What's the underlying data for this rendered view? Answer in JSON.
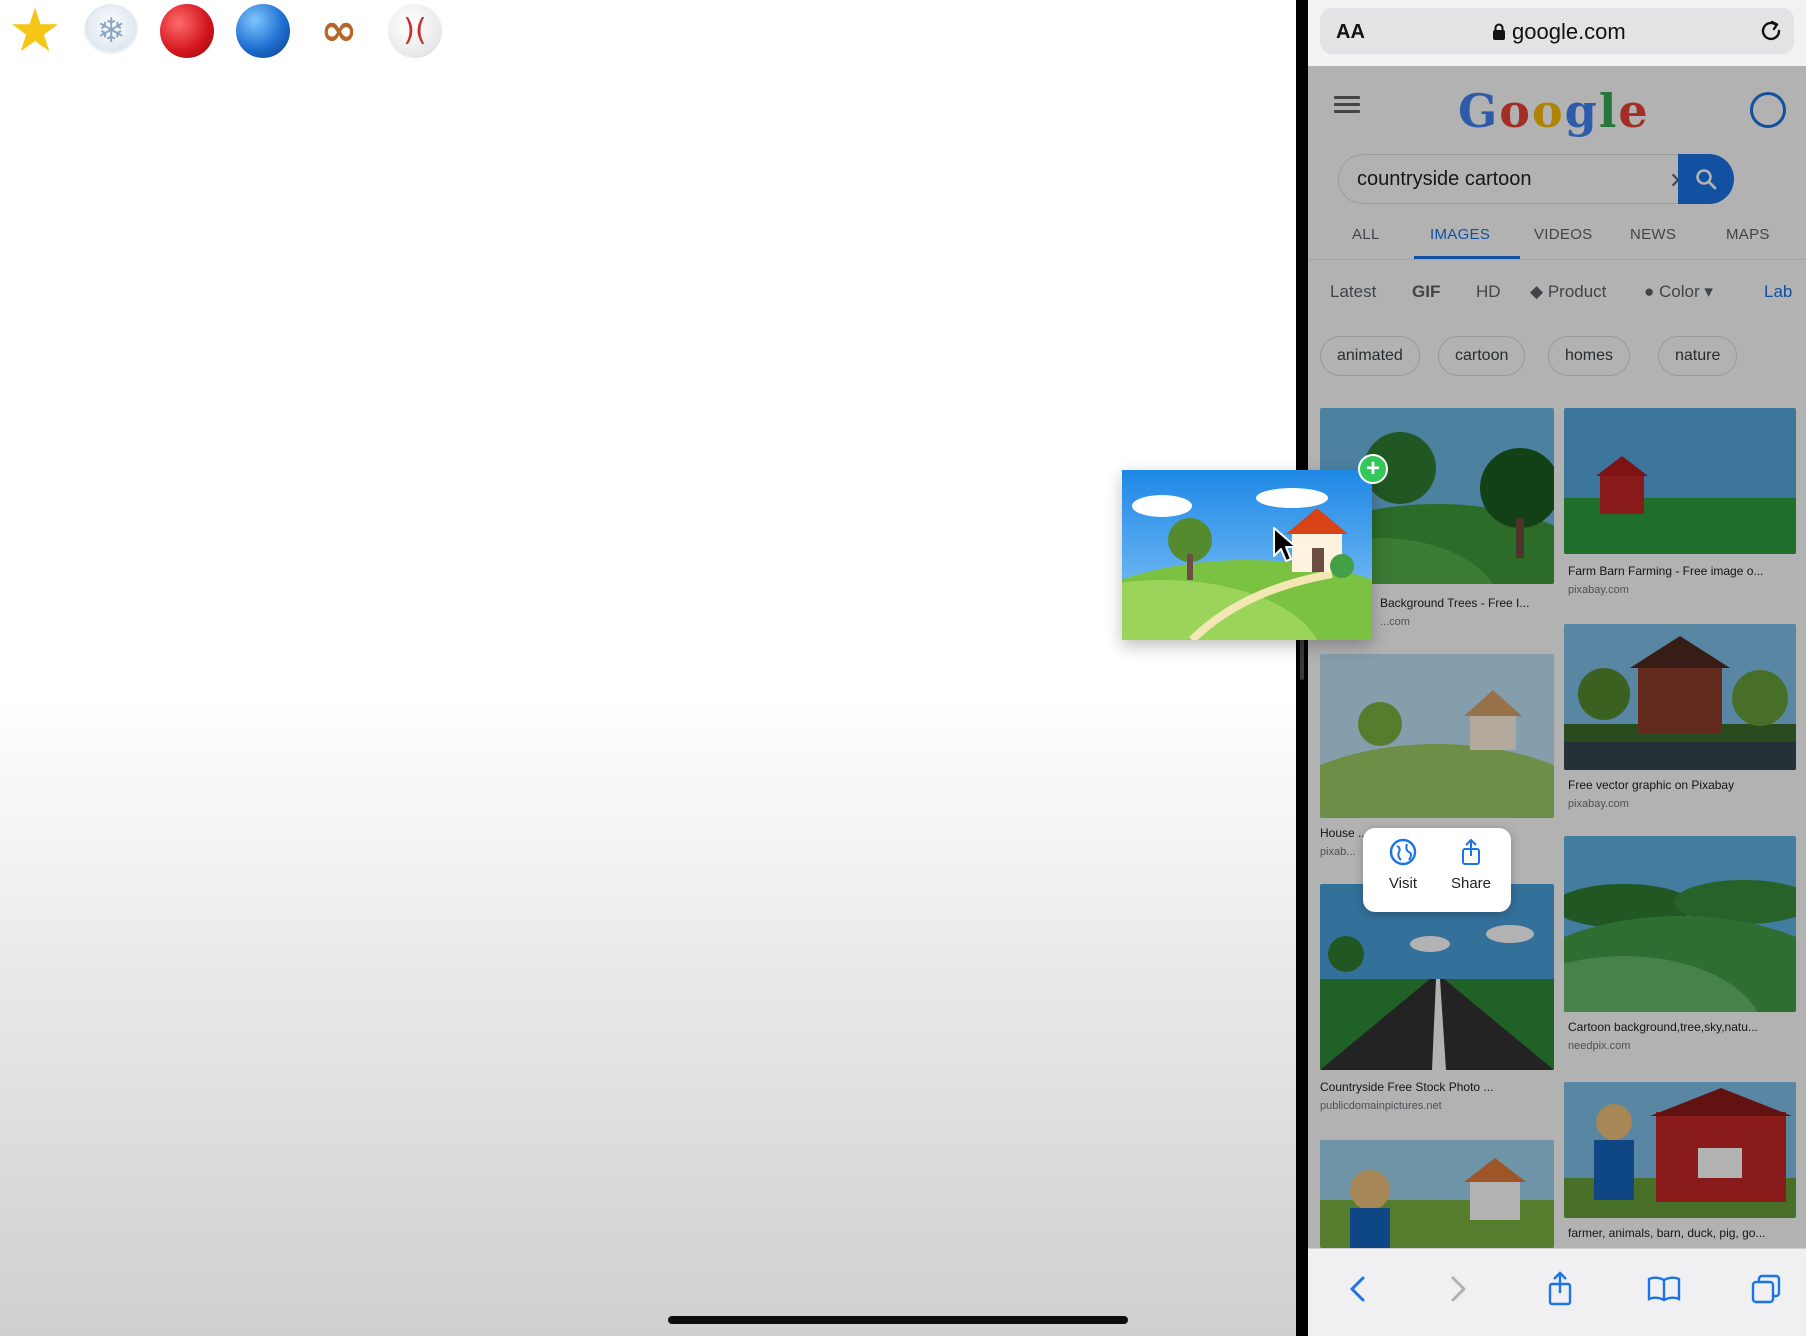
{
  "emoji_bar": {
    "items": [
      {
        "name": "star",
        "glyph": "★"
      },
      {
        "name": "cloud-snow",
        "glyph": "❄"
      },
      {
        "name": "apple",
        "glyph": ""
      },
      {
        "name": "globe",
        "glyph": ""
      },
      {
        "name": "pretzel",
        "glyph": "∞"
      },
      {
        "name": "baseball",
        "glyph": ")("
      }
    ]
  },
  "browser": {
    "aa_label": "AA",
    "url": "google.com"
  },
  "google": {
    "search_query": "countryside cartoon",
    "clear_glyph": "✕",
    "tabs": [
      "ALL",
      "IMAGES",
      "VIDEOS",
      "NEWS",
      "MAPS"
    ],
    "active_tab": "IMAGES",
    "filters": [
      "Latest",
      "GIF",
      "HD",
      "Product",
      "Color",
      "Lab"
    ],
    "chips": [
      "animated",
      "cartoon",
      "homes",
      "nature"
    ],
    "results": [
      {
        "title": "Background Trees - Free I...",
        "source": "...com"
      },
      {
        "title": "Farm Barn Farming - Free image o...",
        "source": "pixabay.com"
      },
      {
        "title": "House ... - F...",
        "source": "pixab..."
      },
      {
        "title": "Free vector graphic on Pixabay",
        "source": "pixabay.com"
      },
      {
        "title": "Countryside Free Stock Photo ...",
        "source": "publicdomainpictures.net"
      },
      {
        "title": "Cartoon background,tree,sky,natu...",
        "source": "needpix.com"
      },
      {
        "title": "farmer, animals, barn, duck, pig, go...",
        "source": ""
      }
    ]
  },
  "context_menu": {
    "visit_label": "Visit",
    "share_label": "Share"
  },
  "drag": {
    "badge_glyph": "+"
  },
  "colors": {
    "google_blue": "#1a73e8",
    "badge_green": "#34c759"
  }
}
